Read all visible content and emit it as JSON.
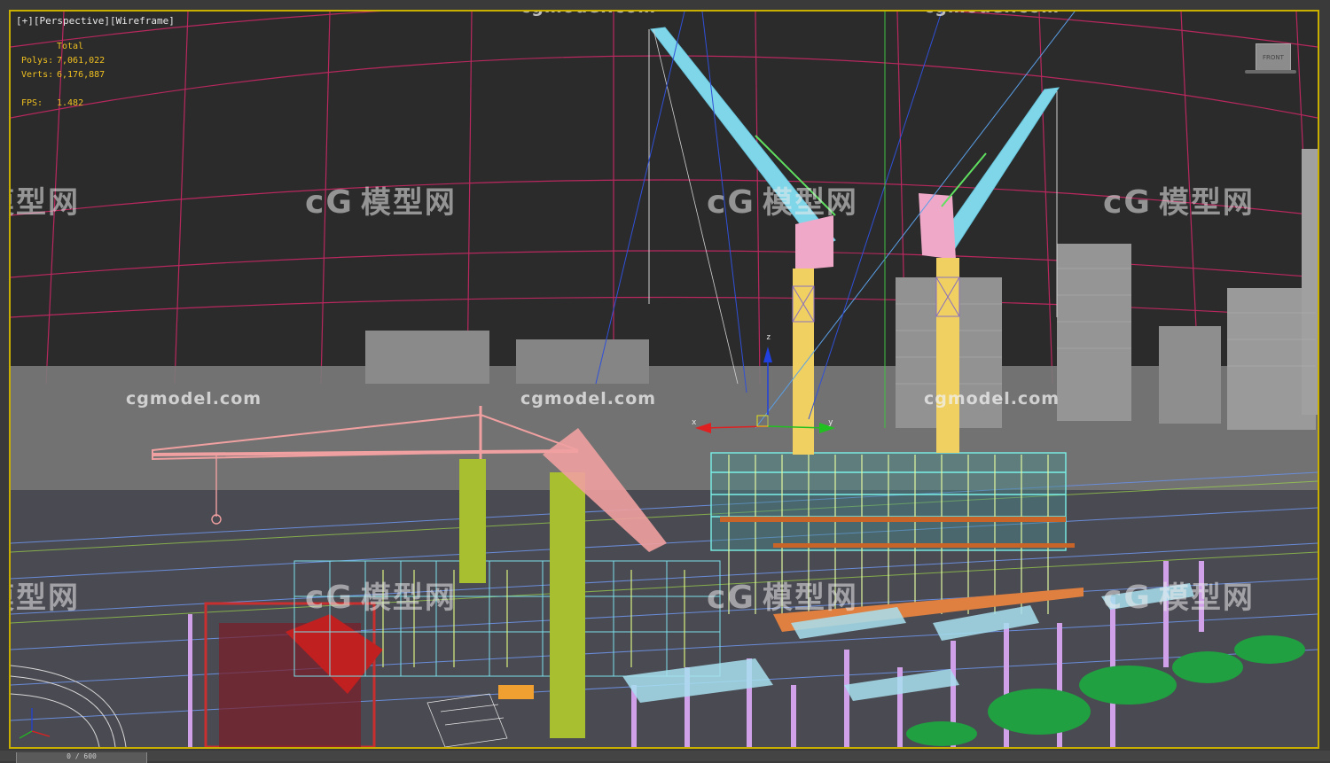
{
  "viewport": {
    "label_plus": "[+]",
    "label_view": "[Perspective]",
    "label_mode": "[Wireframe]"
  },
  "stats": {
    "header": "Total",
    "polys_label": "Polys:",
    "polys_value": "7,061,022",
    "verts_label": "Verts:",
    "verts_value": "6,176,887",
    "fps_label": "FPS:",
    "fps_value": "1.482"
  },
  "watermark": {
    "logo_mark": "cG",
    "logo_text": "模型网",
    "url": "cgmodel.com"
  },
  "viewcube": {
    "face_label": "FRONT"
  },
  "gizmo": {
    "x_label": "x",
    "y_label": "y",
    "z_label": "z"
  },
  "time_slider": {
    "value": "0 / 600"
  },
  "colors": {
    "viewport_border": "#c9b000",
    "stats_text": "#f0c020",
    "crane_cyan": "#7fd6e8",
    "crane_yellow": "#f0d060",
    "crane_pink": "#f0a8c8",
    "crane_olive": "#a8c030",
    "crane_salmon": "#f0a0a0",
    "grid_magenta": "#c02868"
  }
}
